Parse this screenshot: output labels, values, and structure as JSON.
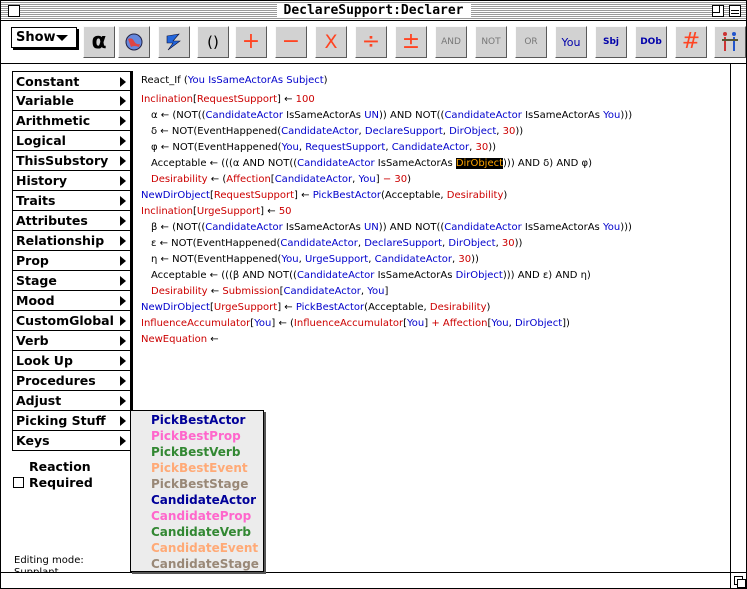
{
  "window": {
    "title": "DeclareSupport:Declarer"
  },
  "toolbar": {
    "show_label": "Show",
    "buttons": [
      {
        "label": "α",
        "color": "#000000"
      },
      {
        "label": "",
        "color": "#cc3333"
      },
      {
        "label": "",
        "color": "#2266dd"
      },
      {
        "label": "()",
        "color": "#000000"
      },
      {
        "label": "+",
        "color": "#ff4422"
      },
      {
        "label": "−",
        "color": "#ff4422"
      },
      {
        "label": "X",
        "color": "#ff4422"
      },
      {
        "label": "÷",
        "color": "#ff4422"
      },
      {
        "label": "±",
        "color": "#ff4422"
      },
      {
        "label": "AND",
        "color": "#777777"
      },
      {
        "label": "NOT",
        "color": "#777777"
      },
      {
        "label": "OR",
        "color": "#777777"
      },
      {
        "label": "You",
        "color": "#0000aa"
      },
      {
        "label": "Sbj",
        "color": "#0000aa"
      },
      {
        "label": "DOb",
        "color": "#0000aa"
      },
      {
        "label": "#",
        "color": "#ff4422"
      },
      {
        "label": "",
        "color": "#cc3333"
      }
    ]
  },
  "categories": [
    "Constant",
    "Variable",
    "Arithmetic",
    "Logical",
    "ThisSubstory",
    "History",
    "Traits",
    "Attributes",
    "Relationship",
    "Prop",
    "Stage",
    "Mood",
    "CustomGlobal",
    "Verb",
    "Look Up",
    "Procedures",
    "Adjust",
    "Picking Stuff",
    "Keys"
  ],
  "submenu": [
    {
      "label": "PickBestActor",
      "color": "#000099"
    },
    {
      "label": "PickBestProp",
      "color": "#ff66cc"
    },
    {
      "label": "PickBestVerb",
      "color": "#338833"
    },
    {
      "label": "PickBestEvent",
      "color": "#ffaa77"
    },
    {
      "label": "PickBestStage",
      "color": "#998877"
    },
    {
      "label": "CandidateActor",
      "color": "#000099"
    },
    {
      "label": "CandidateProp",
      "color": "#ff66cc"
    },
    {
      "label": "CandidateVerb",
      "color": "#338833"
    },
    {
      "label": "CandidateEvent",
      "color": "#ffaa77"
    },
    {
      "label": "CandidateStage",
      "color": "#998877"
    }
  ],
  "reaction": {
    "title": "Reaction",
    "required_label": "Required"
  },
  "editing_mode": {
    "label": "Editing mode:",
    "value": "Supplant"
  },
  "code_lines": [
    {
      "indent": 0,
      "tokens": [
        [
          "k",
          "React_If ("
        ],
        [
          "b",
          "You"
        ],
        [
          "k",
          " "
        ],
        [
          "b",
          "IsSameActorAs"
        ],
        [
          "k",
          " "
        ],
        [
          "b",
          "Subject"
        ],
        [
          "k",
          ")"
        ]
      ]
    },
    {
      "indent": 0,
      "tokens": [
        [
          "r",
          "Inclination"
        ],
        [
          "k",
          "["
        ],
        [
          "r",
          "RequestSupport"
        ],
        [
          "k",
          "] ← "
        ],
        [
          "r",
          "100"
        ]
      ]
    },
    {
      "indent": 1,
      "tokens": [
        [
          "k",
          "α ← (NOT(("
        ],
        [
          "b",
          "CandidateActor"
        ],
        [
          "k",
          " IsSameActorAs "
        ],
        [
          "b",
          "UN"
        ],
        [
          "k",
          ")) AND NOT(("
        ],
        [
          "b",
          "CandidateActor"
        ],
        [
          "k",
          " IsSameActorAs "
        ],
        [
          "b",
          "You"
        ],
        [
          "k",
          ")))"
        ]
      ]
    },
    {
      "indent": 1,
      "tokens": [
        [
          "k",
          "δ ← NOT(EventHappened("
        ],
        [
          "b",
          "CandidateActor"
        ],
        [
          "k",
          ", "
        ],
        [
          "b",
          "DeclareSupport"
        ],
        [
          "k",
          ", "
        ],
        [
          "b",
          "DirObject"
        ],
        [
          "k",
          ", "
        ],
        [
          "r",
          "30"
        ],
        [
          "k",
          "))"
        ]
      ]
    },
    {
      "indent": 1,
      "tokens": [
        [
          "k",
          "φ ← NOT(EventHappened("
        ],
        [
          "b",
          "You"
        ],
        [
          "k",
          ", "
        ],
        [
          "b",
          "RequestSupport"
        ],
        [
          "k",
          ", "
        ],
        [
          "b",
          "CandidateActor"
        ],
        [
          "k",
          ", "
        ],
        [
          "r",
          "30"
        ],
        [
          "k",
          "))"
        ]
      ]
    },
    {
      "indent": 1,
      "tokens": [
        [
          "k",
          "Acceptable ← (((α AND NOT(("
        ],
        [
          "b",
          "CandidateActor"
        ],
        [
          "k",
          " IsSameActorAs "
        ],
        [
          "hl",
          "DirObject"
        ],
        [
          "k",
          "))) AND δ) AND φ)"
        ]
      ]
    },
    {
      "indent": 1,
      "tokens": [
        [
          "r",
          "Desirability"
        ],
        [
          "k",
          " ← ("
        ],
        [
          "r",
          "Affection"
        ],
        [
          "k",
          "["
        ],
        [
          "b",
          "CandidateActor"
        ],
        [
          "k",
          ", "
        ],
        [
          "b",
          "You"
        ],
        [
          "k",
          "] "
        ],
        [
          "r",
          "− 30"
        ],
        [
          "k",
          ")"
        ]
      ]
    },
    {
      "indent": 0,
      "tokens": [
        [
          "b",
          "NewDirObject"
        ],
        [
          "k",
          "["
        ],
        [
          "r",
          "RequestSupport"
        ],
        [
          "k",
          "] ← "
        ],
        [
          "b",
          "PickBestActor"
        ],
        [
          "k",
          "(Acceptable, "
        ],
        [
          "r",
          "Desirability"
        ],
        [
          "k",
          ")"
        ]
      ]
    },
    {
      "indent": 0,
      "tokens": [
        [
          "r",
          "Inclination"
        ],
        [
          "k",
          "["
        ],
        [
          "r",
          "UrgeSupport"
        ],
        [
          "k",
          "] ← "
        ],
        [
          "r",
          "50"
        ]
      ]
    },
    {
      "indent": 1,
      "tokens": [
        [
          "k",
          "β ← (NOT(("
        ],
        [
          "b",
          "CandidateActor"
        ],
        [
          "k",
          " IsSameActorAs "
        ],
        [
          "b",
          "UN"
        ],
        [
          "k",
          ")) AND NOT(("
        ],
        [
          "b",
          "CandidateActor"
        ],
        [
          "k",
          " IsSameActorAs "
        ],
        [
          "b",
          "You"
        ],
        [
          "k",
          ")))"
        ]
      ]
    },
    {
      "indent": 1,
      "tokens": [
        [
          "k",
          "ε ← NOT(EventHappened("
        ],
        [
          "b",
          "CandidateActor"
        ],
        [
          "k",
          ", "
        ],
        [
          "b",
          "DeclareSupport"
        ],
        [
          "k",
          ", "
        ],
        [
          "b",
          "DirObject"
        ],
        [
          "k",
          ", "
        ],
        [
          "r",
          "30"
        ],
        [
          "k",
          "))"
        ]
      ]
    },
    {
      "indent": 1,
      "tokens": [
        [
          "k",
          "η ← NOT(EventHappened("
        ],
        [
          "b",
          "You"
        ],
        [
          "k",
          ", "
        ],
        [
          "b",
          "UrgeSupport"
        ],
        [
          "k",
          ", "
        ],
        [
          "b",
          "CandidateActor"
        ],
        [
          "k",
          ", "
        ],
        [
          "r",
          "30"
        ],
        [
          "k",
          "))"
        ]
      ]
    },
    {
      "indent": 1,
      "tokens": [
        [
          "k",
          "Acceptable ← (((β AND NOT(("
        ],
        [
          "b",
          "CandidateActor"
        ],
        [
          "k",
          " IsSameActorAs "
        ],
        [
          "b",
          "DirObject"
        ],
        [
          "k",
          "))) AND ε) AND η)"
        ]
      ]
    },
    {
      "indent": 1,
      "tokens": [
        [
          "r",
          "Desirability"
        ],
        [
          "k",
          " ← "
        ],
        [
          "r",
          "Submission"
        ],
        [
          "k",
          "["
        ],
        [
          "b",
          "CandidateActor"
        ],
        [
          "k",
          ", "
        ],
        [
          "b",
          "You"
        ],
        [
          "k",
          "]"
        ]
      ]
    },
    {
      "indent": 0,
      "tokens": [
        [
          "b",
          "NewDirObject"
        ],
        [
          "k",
          "["
        ],
        [
          "r",
          "UrgeSupport"
        ],
        [
          "k",
          "] ← "
        ],
        [
          "b",
          "PickBestActor"
        ],
        [
          "k",
          "(Acceptable, "
        ],
        [
          "r",
          "Desirability"
        ],
        [
          "k",
          ")"
        ]
      ]
    },
    {
      "indent": 0,
      "tokens": [
        [
          "r",
          "InfluenceAccumulator"
        ],
        [
          "k",
          "["
        ],
        [
          "b",
          "You"
        ],
        [
          "k",
          "] ← ("
        ],
        [
          "r",
          "InfluenceAccumulator"
        ],
        [
          "k",
          "["
        ],
        [
          "b",
          "You"
        ],
        [
          "k",
          "] "
        ],
        [
          "r",
          "+ Affection"
        ],
        [
          "k",
          "["
        ],
        [
          "b",
          "You"
        ],
        [
          "k",
          ", "
        ],
        [
          "b",
          "DirObject"
        ],
        [
          "k",
          "])"
        ]
      ]
    },
    {
      "indent": 0,
      "tokens": [
        [
          "r",
          "NewEquation"
        ],
        [
          "k",
          " ←"
        ]
      ]
    }
  ]
}
